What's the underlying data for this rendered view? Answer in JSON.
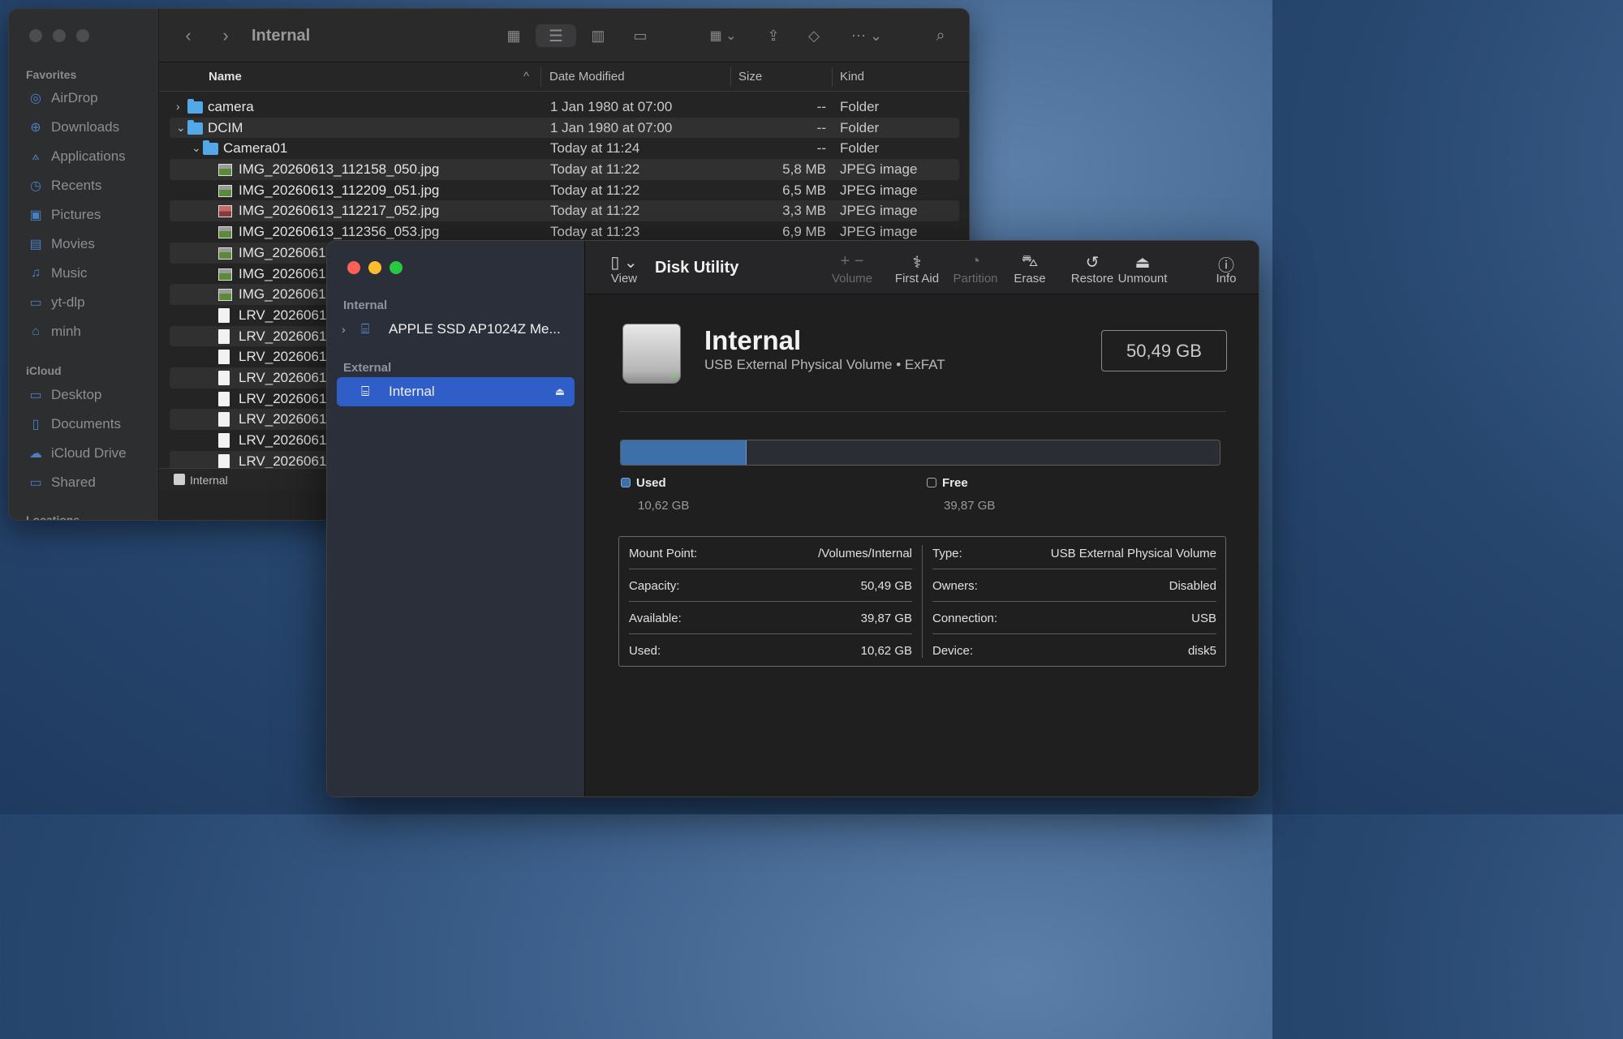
{
  "finder": {
    "title": "Internal",
    "sidebar": {
      "favorites_heading": "Favorites",
      "favorites": [
        {
          "label": "AirDrop",
          "icon": "airdrop-icon"
        },
        {
          "label": "Downloads",
          "icon": "downloads-icon"
        },
        {
          "label": "Applications",
          "icon": "applications-icon"
        },
        {
          "label": "Recents",
          "icon": "recents-icon"
        },
        {
          "label": "Pictures",
          "icon": "pictures-icon"
        },
        {
          "label": "Movies",
          "icon": "movies-icon"
        },
        {
          "label": "Music",
          "icon": "music-icon"
        },
        {
          "label": "yt-dlp",
          "icon": "folder-icon"
        },
        {
          "label": "minh",
          "icon": "home-icon"
        }
      ],
      "icloud_heading": "iCloud",
      "icloud": [
        {
          "label": "Desktop",
          "icon": "desktop-icon"
        },
        {
          "label": "Documents",
          "icon": "documents-icon"
        },
        {
          "label": "iCloud Drive",
          "icon": "cloud-icon"
        },
        {
          "label": "Shared",
          "icon": "shared-folder-icon"
        }
      ],
      "locations_heading": "Locations"
    },
    "columns": {
      "name": "Name",
      "date": "Date Modified",
      "size": "Size",
      "kind": "Kind"
    },
    "rows": [
      {
        "name": "camera",
        "date": "1 Jan 1980 at 07:00",
        "size": "--",
        "kind": "Folder",
        "type": "folder",
        "disclosure": "›"
      },
      {
        "name": "DCIM",
        "date": "1 Jan 1980 at 07:00",
        "size": "--",
        "kind": "Folder",
        "type": "folder",
        "disclosure": "⌄"
      },
      {
        "name": "Camera01",
        "date": "Today at 11:24",
        "size": "--",
        "kind": "Folder",
        "type": "folder",
        "disclosure": "⌄"
      },
      {
        "name": "IMG_20260613_112158_050.jpg",
        "date": "Today at 11:22",
        "size": "5,8 MB",
        "kind": "JPEG image",
        "type": "image"
      },
      {
        "name": "IMG_20260613_112209_051.jpg",
        "date": "Today at 11:22",
        "size": "6,5 MB",
        "kind": "JPEG image",
        "type": "image"
      },
      {
        "name": "IMG_20260613_112217_052.jpg",
        "date": "Today at 11:22",
        "size": "3,3 MB",
        "kind": "JPEG image",
        "type": "image-red"
      },
      {
        "name": "IMG_20260613_112356_053.jpg",
        "date": "Today at 11:23",
        "size": "6,9 MB",
        "kind": "JPEG image",
        "type": "image"
      },
      {
        "name": "IMG_2026061",
        "date": "",
        "size": "",
        "kind": "",
        "type": "image"
      },
      {
        "name": "IMG_2026061",
        "date": "",
        "size": "",
        "kind": "",
        "type": "image"
      },
      {
        "name": "IMG_2026061",
        "date": "",
        "size": "",
        "kind": "",
        "type": "image"
      },
      {
        "name": "LRV_2026061",
        "date": "",
        "size": "",
        "kind": "",
        "type": "doc"
      },
      {
        "name": "LRV_2026061",
        "date": "",
        "size": "",
        "kind": "",
        "type": "doc"
      },
      {
        "name": "LRV_2026061",
        "date": "",
        "size": "",
        "kind": "",
        "type": "doc"
      },
      {
        "name": "LRV_2026061",
        "date": "",
        "size": "",
        "kind": "",
        "type": "doc"
      },
      {
        "name": "LRV_2026061",
        "date": "",
        "size": "",
        "kind": "",
        "type": "doc"
      },
      {
        "name": "LRV_2026061",
        "date": "",
        "size": "",
        "kind": "",
        "type": "doc"
      },
      {
        "name": "LRV_2026061",
        "date": "",
        "size": "",
        "kind": "",
        "type": "doc"
      },
      {
        "name": "LRV_2026061",
        "date": "",
        "size": "",
        "kind": "",
        "type": "doc"
      }
    ],
    "status_path": "Internal"
  },
  "disk_utility": {
    "title": "Disk Utility",
    "view_label": "View",
    "tools": [
      {
        "label": "Volume",
        "glyph": "+  −",
        "enabled": false
      },
      {
        "label": "First Aid",
        "glyph": "⚕",
        "enabled": true
      },
      {
        "label": "Partition",
        "glyph": "◔",
        "enabled": false
      },
      {
        "label": "Erase",
        "glyph": "⛍",
        "enabled": true
      },
      {
        "label": "Restore",
        "glyph": "↺",
        "enabled": true
      },
      {
        "label": "Unmount",
        "glyph": "⏏",
        "enabled": true
      },
      {
        "label": "Info",
        "glyph": "ⓘ",
        "enabled": true
      }
    ],
    "sidebar": {
      "internal_heading": "Internal",
      "internal_device": "APPLE SSD AP1024Z Me...",
      "external_heading": "External",
      "external_device": "Internal"
    },
    "volume": {
      "name": "Internal",
      "description": "USB External Physical Volume • ExFAT",
      "capacity": "50,49 GB"
    },
    "usage": {
      "used_fraction": 0.2104,
      "used_label": "Used",
      "used_value": "10,62 GB",
      "free_label": "Free",
      "free_value": "39,87 GB",
      "used_color": "#3d6fa8"
    },
    "info_left": [
      {
        "k": "Mount Point:",
        "v": "/Volumes/Internal"
      },
      {
        "k": "Capacity:",
        "v": "50,49 GB"
      },
      {
        "k": "Available:",
        "v": "39,87 GB"
      },
      {
        "k": "Used:",
        "v": "10,62 GB"
      }
    ],
    "info_right": [
      {
        "k": "Type:",
        "v": "USB External Physical Volume"
      },
      {
        "k": "Owners:",
        "v": "Disabled"
      },
      {
        "k": "Connection:",
        "v": "USB"
      },
      {
        "k": "Device:",
        "v": "disk5"
      }
    ]
  }
}
